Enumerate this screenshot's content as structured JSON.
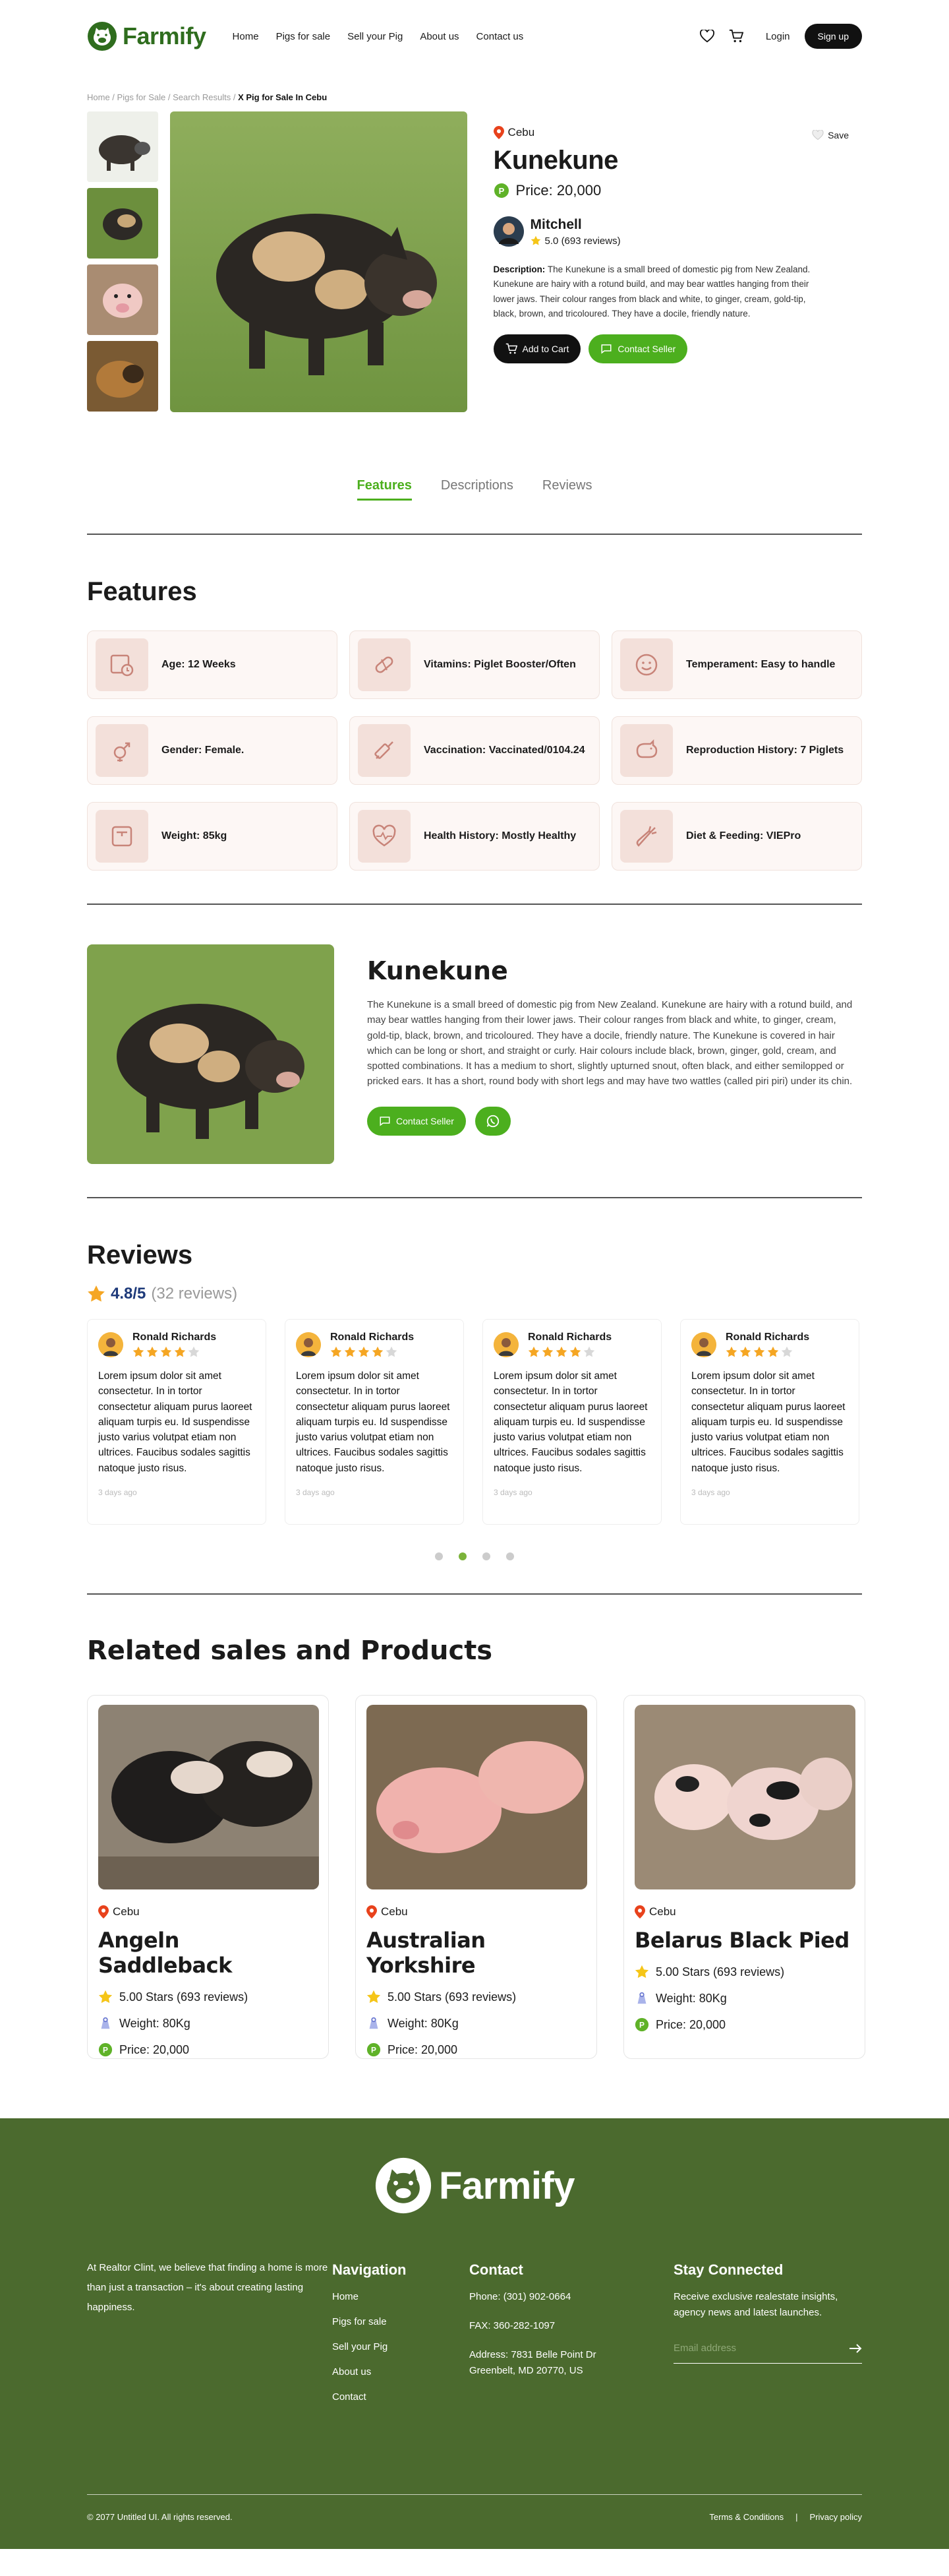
{
  "brand": {
    "name": "Farmify"
  },
  "nav": {
    "items": [
      "Home",
      "Pigs for sale",
      "Sell your Pig",
      "About us",
      "Contact us"
    ],
    "login": "Login",
    "signup": "Sign up"
  },
  "breadcrumb": {
    "items": [
      "Home",
      "Pigs for Sale",
      "Search Results"
    ],
    "current": "X Pig for Sale In Cebu"
  },
  "product": {
    "location": "Cebu",
    "save": "Save",
    "title": "Kunekune",
    "price": "Price: 20,000",
    "seller": {
      "name": "Mitchell",
      "rating": "5.0 (693 reviews)"
    },
    "desc_label": "Description:",
    "description": "The Kunekune is a small breed of domestic pig from New Zealand. Kunekune are hairy with a rotund build, and may bear wattles hanging from their lower jaws. Their colour ranges from black and white, to ginger, cream, gold-tip, black, brown, and tricoloured. They have a docile, friendly nature.",
    "add_to_cart": "Add to Cart",
    "contact_seller": "Contact Seller"
  },
  "tabs": [
    "Features",
    "Descriptions",
    "Reviews"
  ],
  "features": {
    "title": "Features",
    "items": [
      {
        "label": "Age: 12 Weeks",
        "icon": "calendar-clock-icon"
      },
      {
        "label": "Vitamins: Piglet Booster/Often",
        "icon": "pill-icon"
      },
      {
        "label": "Temperament: Easy to handle",
        "icon": "smile-icon"
      },
      {
        "label": "Gender: Female.",
        "icon": "gender-icon"
      },
      {
        "label": "Vaccination: Vaccinated/0104.24",
        "icon": "syringe-icon"
      },
      {
        "label": "Reproduction History: 7 Piglets",
        "icon": "pig-icon"
      },
      {
        "label": "Weight: 85kg",
        "icon": "scale-icon"
      },
      {
        "label": "Health History: Mostly Healthy",
        "icon": "heartbeat-icon"
      },
      {
        "label": "Diet & Feeding: VIEPro",
        "icon": "carrot-icon"
      }
    ]
  },
  "detail": {
    "title": "Kunekune",
    "text": "The Kunekune is a small breed of domestic pig from New Zealand. Kunekune are hairy with a rotund build, and may bear wattles hanging from their lower jaws. Their colour ranges from black and white, to ginger, cream, gold-tip, black, brown, and tricoloured. They have a docile, friendly nature.  The Kunekune is covered in hair which can be long or short, and straight or curly. Hair colours include black, brown, ginger, gold, cream, and spotted combinations. It has a medium to short, slightly upturned snout, often black, and either semilopped or pricked ears. It has a short, round body with short legs and may have two wattles (called piri piri) under its chin.",
    "contact": "Contact Seller"
  },
  "reviews": {
    "title": "Reviews",
    "score": "4.8/5",
    "count": "(32 reviews)",
    "items": [
      {
        "name": "Ronald Richards",
        "stars": 4,
        "text": "Lorem ipsum dolor sit amet consectetur. In in tortor consectetur aliquam purus laoreet aliquam turpis eu. Id suspendisse justo varius volutpat etiam non ultrices. Faucibus sodales sagittis natoque justo risus.",
        "date": "3 days ago"
      },
      {
        "name": "Ronald Richards",
        "stars": 4,
        "text": "Lorem ipsum dolor sit amet consectetur. In in tortor consectetur aliquam purus laoreet aliquam turpis eu. Id suspendisse justo varius volutpat etiam non ultrices. Faucibus sodales sagittis natoque justo risus.",
        "date": "3 days ago"
      },
      {
        "name": "Ronald Richards",
        "stars": 4,
        "text": "Lorem ipsum dolor sit amet consectetur. In in tortor consectetur aliquam purus laoreet aliquam turpis eu. Id suspendisse justo varius volutpat etiam non ultrices. Faucibus sodales sagittis natoque justo risus.",
        "date": "3 days ago"
      },
      {
        "name": "Ronald Richards",
        "stars": 4,
        "text": "Lorem ipsum dolor sit amet consectetur. In in tortor consectetur aliquam purus laoreet aliquam turpis eu. Id suspendisse justo varius volutpat etiam non ultrices. Faucibus sodales sagittis natoque justo risus.",
        "date": "3 days ago"
      }
    ],
    "active_page": 2,
    "pages": 4
  },
  "related": {
    "title": "Related sales and Products",
    "items": [
      {
        "location": "Cebu",
        "title": "Angeln Saddleback",
        "rating": "5.00 Stars (693 reviews)",
        "weight": "Weight: 80Kg",
        "price": "Price: 20,000"
      },
      {
        "location": "Cebu",
        "title": "Australian Yorkshire",
        "rating": "5.00 Stars (693 reviews)",
        "weight": "Weight: 80Kg",
        "price": "Price: 20,000"
      },
      {
        "location": "Cebu",
        "title": "Belarus Black Pied",
        "rating": "5.00 Stars (693 reviews)",
        "weight": "Weight: 80Kg",
        "price": "Price: 20,000"
      }
    ]
  },
  "footer": {
    "about": "At Realtor Clint, we believe that finding a home is more than just a transaction – it's about creating lasting happiness.",
    "nav_title": "Navigation",
    "nav": [
      "Home",
      "Pigs for sale",
      "Sell your Pig",
      "About us",
      "Contact"
    ],
    "contact_title": "Contact",
    "phone": "Phone: (301) 902-0664",
    "fax": "FAX: 360-282-1097",
    "address": "Address: 7831 Belle Point Dr Greenbelt, MD 20770, US",
    "stay_title": "Stay Connected",
    "stay_text": "Receive exclusive realestate insights, agency news and latest launches.",
    "email_placeholder": "Email address",
    "copyright": "© 2077 Untitled UI. All rights reserved.",
    "terms": "Terms & Conditions",
    "separator": "|",
    "privacy": "Privacy policy"
  },
  "colors": {
    "brand_green": "#2f6d1e",
    "accent_green": "#4caf1e",
    "footer_bg": "#4b6a2e",
    "star": "#f5a623"
  }
}
